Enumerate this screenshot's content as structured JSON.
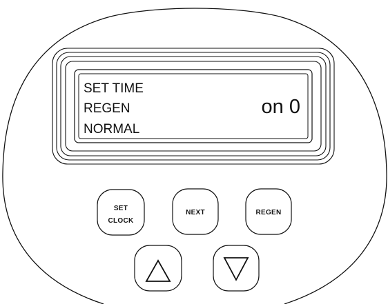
{
  "display": {
    "modes": [
      {
        "label": "SET TIME",
        "active": false
      },
      {
        "label": "REGEN",
        "active": false
      },
      {
        "label": "NORMAL",
        "active": false
      }
    ],
    "value": "on 0"
  },
  "buttons": {
    "set_clock": {
      "line1": "SET",
      "line2": "CLOCK"
    },
    "next": {
      "label": "NEXT"
    },
    "regen": {
      "label": "REGEN"
    },
    "up": {
      "icon": "up-triangle-icon"
    },
    "down": {
      "icon": "down-triangle-icon"
    }
  },
  "colors": {
    "outline": "#111111",
    "background": "#ffffff"
  }
}
